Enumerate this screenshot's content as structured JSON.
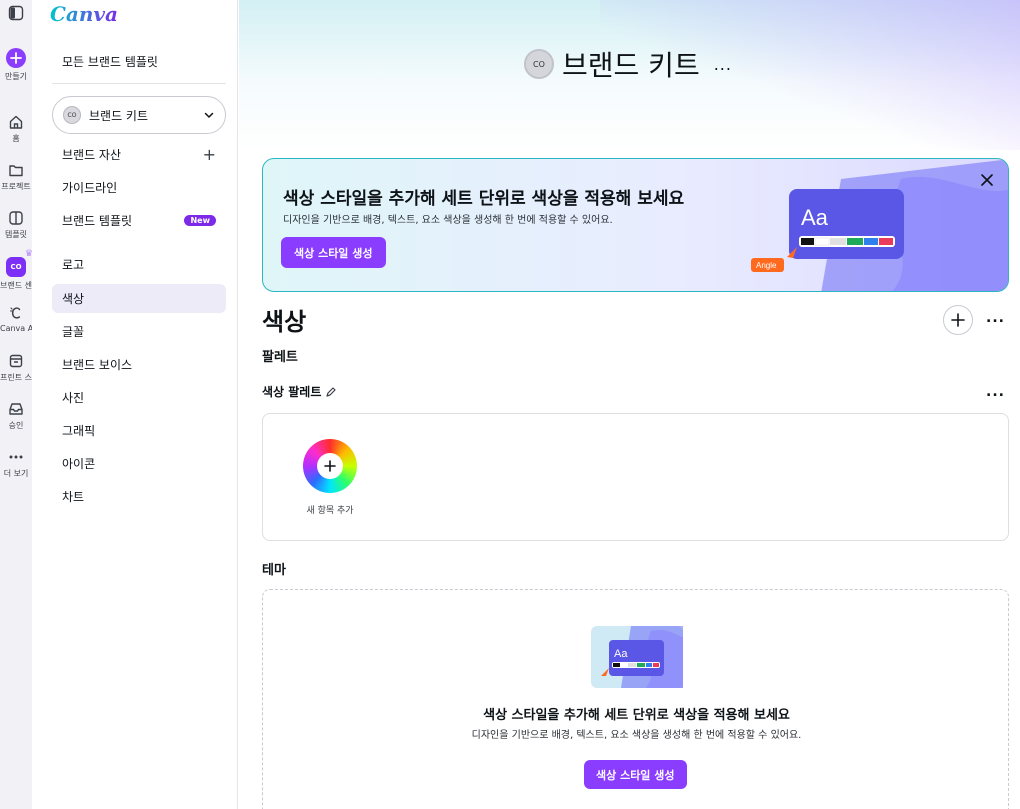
{
  "rail": {
    "create_label": "만들기",
    "items": [
      {
        "label": "홈",
        "icon": "home-icon"
      },
      {
        "label": "프로젝트",
        "icon": "folder-icon"
      },
      {
        "label": "템플릿",
        "icon": "template-icon"
      },
      {
        "label": "브랜드 센터",
        "icon": "brand-icon"
      },
      {
        "label": "Canva AI",
        "icon": "canva-ai-icon"
      },
      {
        "label": "프린트 스...",
        "icon": "print-icon"
      },
      {
        "label": "승인",
        "icon": "inbox-icon"
      },
      {
        "label": "더 보기",
        "icon": "more-icon"
      }
    ]
  },
  "sidebar": {
    "logo": "Canva",
    "all_templates": "모든 브랜드 템플릿",
    "kit_select": {
      "avatar": "CO",
      "label": "브랜드 키트"
    },
    "items": [
      {
        "label": "브랜드 자산",
        "action": "+"
      },
      {
        "label": "가이드라인"
      },
      {
        "label": "브랜드 템플릿",
        "badge": "New"
      },
      {
        "label": "로고"
      },
      {
        "label": "색상"
      },
      {
        "label": "글꼴"
      },
      {
        "label": "브랜드 보이스"
      },
      {
        "label": "사진"
      },
      {
        "label": "그래픽"
      },
      {
        "label": "아이콘"
      },
      {
        "label": "차트"
      }
    ]
  },
  "header": {
    "avatar": "CO",
    "title": "브랜드 키트",
    "more": "..."
  },
  "banner": {
    "title": "색상 스타일을 추가해 세트 단위로 색상을 적용해 보세요",
    "subtitle": "디자인을 기반으로 배경, 텍스트, 요소 색상을 생성해 한 번에 적용할 수 있어요.",
    "button": "색상 스타일 생성",
    "art_text": "Aa",
    "art_tag": "Angle"
  },
  "colors": {
    "heading": "색상",
    "palette_heading": "팔레트",
    "color_palette_label": "색상 팔레트",
    "add_new_label": "새 항목 추가",
    "more": "..."
  },
  "theme": {
    "heading": "테마",
    "art_text": "Aa",
    "title": "색상 스타일을 추가해 세트 단위로 색상을 적용해 보세요",
    "subtitle": "디자인을 기반으로 배경, 텍스트, 요소 색상을 생성해 한 번에 적용할 수 있어요.",
    "button": "색상 스타일 생성"
  },
  "palette_colors": {
    "accent": "#8b3dff",
    "swatches": [
      "#111111",
      "#ffffff",
      "#e0e0e0",
      "#1faa59",
      "#2f80ed",
      "#eb3b5a"
    ]
  }
}
